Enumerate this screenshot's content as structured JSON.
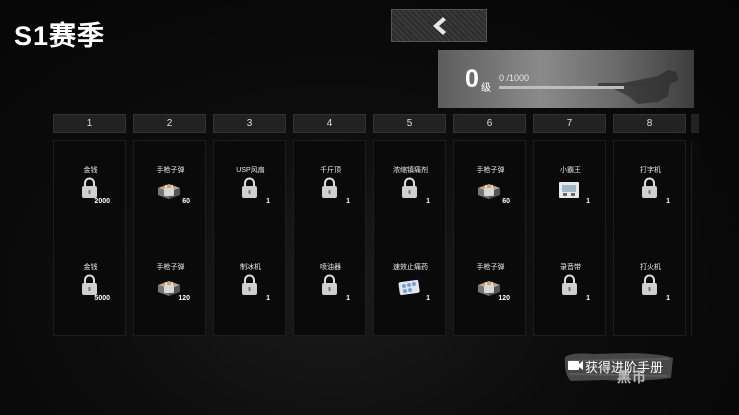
{
  "header": {
    "season_title": "S1赛季"
  },
  "back_button": {
    "icon": "chevron-left-icon"
  },
  "level": {
    "value": "0",
    "unit": "级",
    "xp_text": "0 /1000",
    "progress": 0.0
  },
  "columns": [
    {
      "label": "1",
      "items": [
        {
          "name": "金钱",
          "qty": "2000",
          "icon": "lock-icon"
        },
        {
          "name": "金钱",
          "qty": "5000",
          "icon": "lock-icon"
        }
      ]
    },
    {
      "label": "2",
      "items": [
        {
          "name": "手枪子弹",
          "qty": "60",
          "icon": "ammo-box-icon"
        },
        {
          "name": "手枪子弹",
          "qty": "120",
          "icon": "ammo-box-icon"
        }
      ]
    },
    {
      "label": "3",
      "items": [
        {
          "name": "USP风扇",
          "qty": "1",
          "icon": "lock-icon"
        },
        {
          "name": "制冰机",
          "qty": "1",
          "icon": "lock-icon"
        }
      ]
    },
    {
      "label": "4",
      "items": [
        {
          "name": "千斤顶",
          "qty": "1",
          "icon": "lock-icon"
        },
        {
          "name": "喷油器",
          "qty": "1",
          "icon": "lock-icon"
        }
      ]
    },
    {
      "label": "5",
      "items": [
        {
          "name": "浓缩镇痛剂",
          "qty": "1",
          "icon": "lock-icon"
        },
        {
          "name": "速效止痛药",
          "qty": "1",
          "icon": "pill-pack-icon"
        }
      ]
    },
    {
      "label": "6",
      "items": [
        {
          "name": "手枪子弹",
          "qty": "60",
          "icon": "ammo-box-icon"
        },
        {
          "name": "手枪子弹",
          "qty": "120",
          "icon": "ammo-box-icon"
        }
      ]
    },
    {
      "label": "7",
      "items": [
        {
          "name": "小霸王",
          "qty": "1",
          "icon": "console-icon"
        },
        {
          "name": "录音带",
          "qty": "1",
          "icon": "lock-icon"
        }
      ]
    },
    {
      "label": "8",
      "items": [
        {
          "name": "打字机",
          "qty": "1",
          "icon": "lock-icon"
        },
        {
          "name": "打火机",
          "qty": "1",
          "icon": "lock-icon"
        }
      ]
    }
  ],
  "unlock_button": {
    "label": "获得进阶手册",
    "currency": "黑币",
    "icon": "camera-icon"
  }
}
